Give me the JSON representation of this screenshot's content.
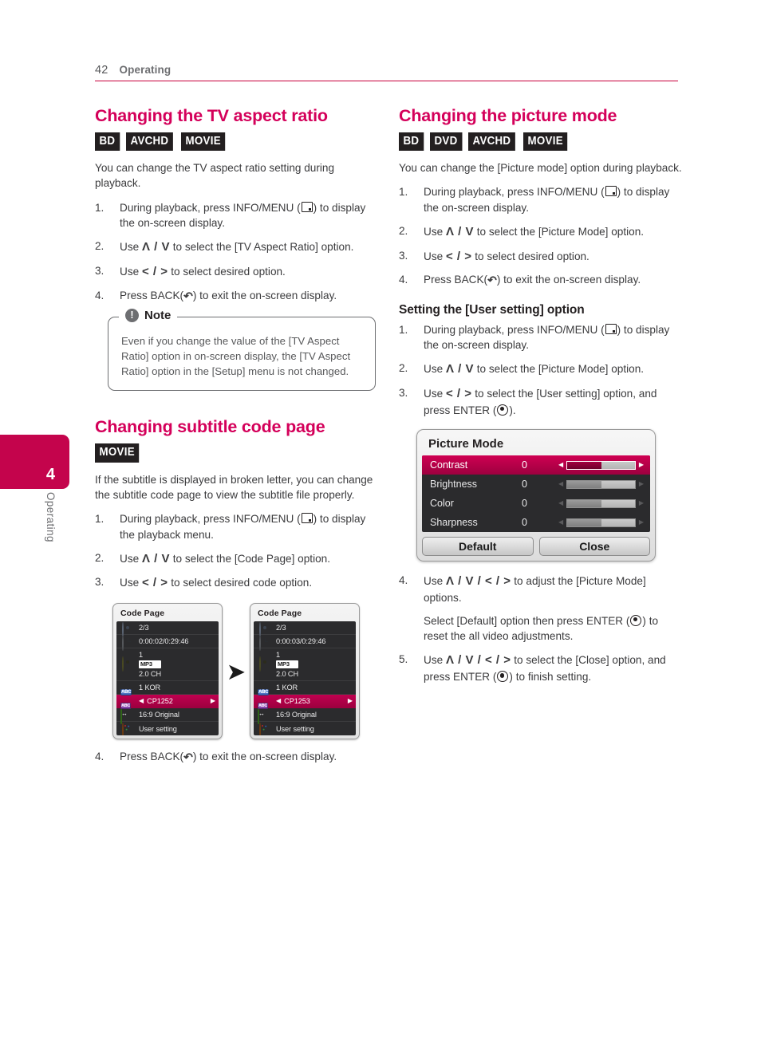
{
  "header": {
    "page_number": "42",
    "section": "Operating",
    "rule_color": "#c8003c"
  },
  "chapter_tab": {
    "number": "4",
    "label": "Operating",
    "color": "#c4044c"
  },
  "left_column": {
    "section1": {
      "title": "Changing the TV aspect ratio",
      "badges": [
        "BD",
        "AVCHD",
        "MOVIE"
      ],
      "intro": "You can change the TV aspect ratio setting during playback.",
      "steps": [
        {
          "num": "1.",
          "a": "During playback, press INFO/MENU (",
          "b": ") to display the on-screen display."
        },
        {
          "num": "2.",
          "a": "Use ",
          "keys": "Λ / V",
          "b": " to select the [TV Aspect Ratio] option."
        },
        {
          "num": "3.",
          "a": "Use ",
          "keys": "< / >",
          "b": " to select desired option."
        },
        {
          "num": "4.",
          "a": "Press BACK(",
          "b": ") to exit the on-screen display."
        }
      ],
      "note": {
        "title": "Note",
        "icon": "exclamation-icon",
        "text": "Even if you change the value of the [TV Aspect Ratio] option in on-screen display, the [TV Aspect Ratio] option in the [Setup] menu is not changed."
      }
    },
    "section2": {
      "title": "Changing subtitle code page",
      "badges": [
        "MOVIE"
      ],
      "intro": "If the subtitle is displayed in broken letter, you can change the subtitle code page to view the subtitle file properly.",
      "steps": [
        {
          "num": "1.",
          "a": "During playback, press INFO/MENU (",
          "b": ") to display the playback menu."
        },
        {
          "num": "2.",
          "a": "Use ",
          "keys": "Λ / V",
          "b": " to select the [Code Page] option."
        },
        {
          "num": "3.",
          "a": "Use ",
          "keys": "< / >",
          "b": " to select desired code option."
        }
      ],
      "final_step": {
        "num": "4.",
        "a": "Press BACK(",
        "b": ") to exit the on-screen display."
      },
      "osd_before": {
        "title": "Code Page",
        "items": [
          {
            "icon": "disc-icon",
            "text": "2/3"
          },
          {
            "icon": "clock-icon",
            "text": "0:00:02/0:29:46"
          },
          {
            "icon": "audio-icon",
            "line1": "1",
            "tag": "MP3",
            "line3": "2.0 CH"
          },
          {
            "icon": "subtitle-abc-icon",
            "text": "1 KOR"
          },
          {
            "icon": "code-page-icon",
            "text": "CP1252",
            "selected": true
          },
          {
            "icon": "aspect-ratio-icon",
            "text": "16:9 Original"
          },
          {
            "icon": "palette-icon",
            "text": "User setting"
          }
        ]
      },
      "transition_icon": "right-arrow-icon",
      "osd_after": {
        "title": "Code Page",
        "items": [
          {
            "icon": "disc-icon",
            "text": "2/3"
          },
          {
            "icon": "clock-icon",
            "text": "0:00:03/0:29:46"
          },
          {
            "icon": "audio-icon",
            "line1": "1",
            "tag": "MP3",
            "line3": "2.0 CH"
          },
          {
            "icon": "subtitle-abc-icon",
            "text": "1 KOR"
          },
          {
            "icon": "code-page-icon",
            "text": "CP1253",
            "selected": true
          },
          {
            "icon": "aspect-ratio-icon",
            "text": "16:9 Original"
          },
          {
            "icon": "palette-icon",
            "text": "User setting"
          }
        ]
      }
    }
  },
  "right_column": {
    "section1": {
      "title": "Changing the picture mode",
      "badges": [
        "BD",
        "DVD",
        "AVCHD",
        "MOVIE"
      ],
      "intro": "You can change the [Picture mode] option during playback.",
      "steps": [
        {
          "num": "1.",
          "a": "During playback, press INFO/MENU (",
          "b": ") to display the on-screen display."
        },
        {
          "num": "2.",
          "a": "Use ",
          "keys": "Λ / V",
          "b": " to select the [Picture Mode] option."
        },
        {
          "num": "3.",
          "a": "Use ",
          "keys": "< / >",
          "b": " to select desired option."
        },
        {
          "num": "4.",
          "a": "Press BACK(",
          "b": ") to exit the on-screen display."
        }
      ]
    },
    "section2": {
      "title": "Setting the [User setting] option",
      "steps": [
        {
          "num": "1.",
          "a": "During playback, press INFO/MENU (",
          "b": ") to display the on-screen display."
        },
        {
          "num": "2.",
          "a": "Use ",
          "keys": "Λ / V",
          "b": " to select the [Picture Mode] option."
        },
        {
          "num": "3.",
          "a": "Use ",
          "keys": "< / >",
          "b": " to select the [User setting] option, and press ENTER (",
          "c": ")."
        }
      ],
      "osd_picture_mode": {
        "title": "Picture Mode",
        "rows": [
          {
            "label": "Contrast",
            "value": "0",
            "fill_percent": 50,
            "selected": true
          },
          {
            "label": "Brightness",
            "value": "0",
            "fill_percent": 50,
            "selected": false
          },
          {
            "label": "Color",
            "value": "0",
            "fill_percent": 50,
            "selected": false
          },
          {
            "label": "Sharpness",
            "value": "0",
            "fill_percent": 50,
            "selected": false
          }
        ],
        "buttons": [
          "Default",
          "Close"
        ]
      },
      "steps_after": [
        {
          "num": "4.",
          "a": "Use ",
          "keys": "Λ / V / < / >",
          "b": " to adjust the [Picture Mode] options."
        },
        {
          "num": "5.",
          "a": "Use ",
          "keys": "Λ / V / < / >",
          "b": " to select the [Close] option, and press ENTER (",
          "c": ") to finish setting."
        }
      ],
      "sub_paragraph": {
        "a": "Select [Default] option then press ENTER (",
        "b": ") to reset the all video adjustments."
      }
    }
  }
}
